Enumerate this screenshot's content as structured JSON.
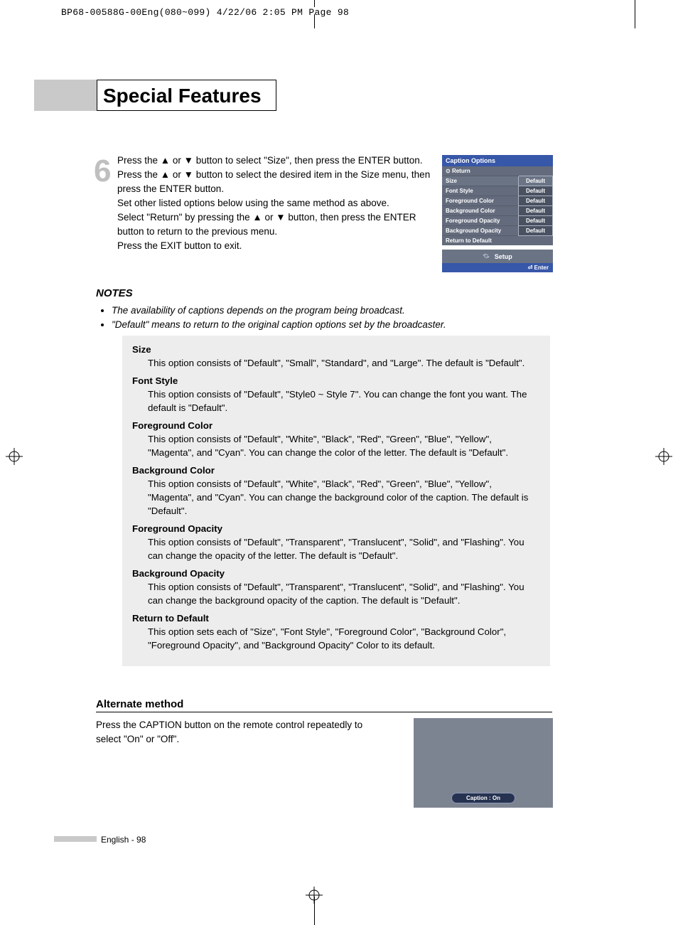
{
  "header_line": "BP68-00588G-00Eng(080~099)  4/22/06  2:05 PM  Page 98",
  "title": "Special Features",
  "step_number": "6",
  "step_text": {
    "l1": "Press the ▲ or ▼ button to select \"Size\", then press the ENTER button.",
    "l2": "Press the ▲ or ▼ button to select the desired item in the Size menu, then press the ENTER button.",
    "l3": "Set other listed options below using the same method as above.",
    "l4": "Select \"Return\" by pressing the ▲ or ▼ button, then press the ENTER button to return to the previous menu.",
    "l5": "Press the EXIT button to exit."
  },
  "osd": {
    "title": "Caption Options",
    "return": "Return",
    "rows": [
      {
        "label": "Size",
        "value": "Default"
      },
      {
        "label": "Font Style",
        "value": "Default"
      },
      {
        "label": "Foreground Color",
        "value": "Default"
      },
      {
        "label": "Background Color",
        "value": "Default"
      },
      {
        "label": "Foreground Opacity",
        "value": "Default"
      },
      {
        "label": "Background Opacity",
        "value": "Default"
      },
      {
        "label": "Return to Default",
        "value": ""
      }
    ],
    "setup": "Setup",
    "enter": "Enter"
  },
  "notes_h": "NOTES",
  "notes": {
    "n1": "The availability of captions depends on the program being broadcast.",
    "n2": "\"Default\" means to return to the original caption options set by the broadcaster."
  },
  "options": [
    {
      "h": "Size",
      "d": "This option consists of \"Default\", \"Small\", \"Standard\", and \"Large\". The default is \"Default\"."
    },
    {
      "h": "Font Style",
      "d": "This option consists of \"Default\", \"Style0 ~ Style 7\". You can change the font you want. The default is \"Default\"."
    },
    {
      "h": "Foreground Color",
      "d": "This option consists of \"Default\", \"White\", \"Black\", \"Red\", \"Green\", \"Blue\", \"Yellow\", \"Magenta\", and \"Cyan\". You can change the color of the letter. The default is \"Default\"."
    },
    {
      "h": "Background Color",
      "d": "This option consists of \"Default\", \"White\", \"Black\", \"Red\", \"Green\", \"Blue\", \"Yellow\", \"Magenta\", and \"Cyan\". You can change the background color of the caption. The default is \"Default\"."
    },
    {
      "h": "Foreground Opacity",
      "d": "This option consists of \"Default\", \"Transparent\", \"Translucent\", \"Solid\", and \"Flashing\". You can change the opacity of the letter. The default is \"Default\"."
    },
    {
      "h": "Background Opacity",
      "d": "This option consists of \"Default\", \"Transparent\", \"Translucent\", \"Solid\", and \"Flashing\". You can change the background opacity of the caption. The default is \"Default\"."
    },
    {
      "h": "Return to Default",
      "d": "This option sets each of \"Size\", \"Font Style\", \"Foreground Color\", \"Background Color\", \"Foreground Opacity\", and \"Background Opacity\" Color to its default."
    }
  ],
  "alt_h": "Alternate method",
  "alt_p": "Press the CAPTION button on the remote control repeatedly to select \"On\" or \"Off\".",
  "tv_caption": "Caption : On",
  "footer": "English - 98"
}
